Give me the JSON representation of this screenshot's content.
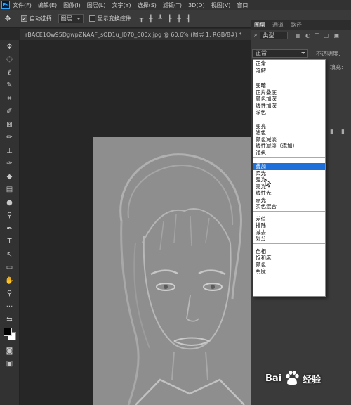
{
  "app": {
    "logo": "Ps"
  },
  "menubar": {
    "items": [
      "文件(F)",
      "编辑(E)",
      "图像(I)",
      "图层(L)",
      "文字(Y)",
      "选择(S)",
      "滤镜(T)",
      "3D(D)",
      "视图(V)",
      "窗口"
    ]
  },
  "options": {
    "auto_select_label": "自动选择:",
    "auto_select_value": "图层",
    "show_transform_label": "显示变换控件"
  },
  "document_tab": {
    "title": "rBACE1Qw95DgwpZNAAF_sOD1u_l070_600x.jpg @ 60.6% (图层 1, RGB/8#) *"
  },
  "layers_panel": {
    "tabs": [
      "图层",
      "通道",
      "路径"
    ],
    "kind_label": "类型",
    "blend_mode": "正常",
    "opacity_label": "不透明度:",
    "fill_label": "填充:"
  },
  "blend_menu": {
    "groups": [
      [
        "正常",
        "溶解"
      ],
      [
        "变暗",
        "正片叠底",
        "颜色加深",
        "线性加深",
        "深色"
      ],
      [
        "变亮",
        "滤色",
        "颜色减淡",
        "线性减淡（添加）",
        "浅色"
      ],
      [
        "叠加",
        "柔光",
        "强光",
        "亮光",
        "线性光",
        "点光",
        "实色混合"
      ],
      [
        "差值",
        "排除",
        "减去",
        "划分"
      ],
      [
        "色相",
        "饱和度",
        "颜色",
        "明度"
      ]
    ],
    "selected": "叠加"
  },
  "watermark": {
    "text_left": "Bai",
    "text_right": "经验"
  }
}
